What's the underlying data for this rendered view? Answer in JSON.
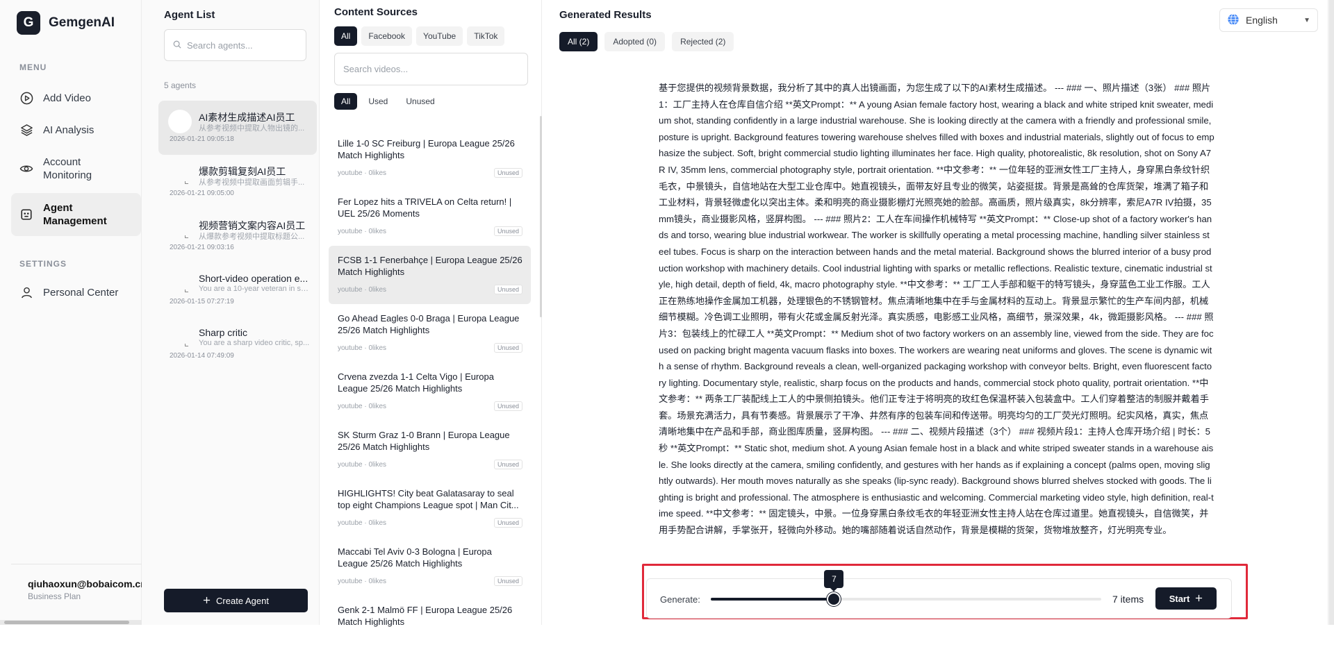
{
  "brand": {
    "logo_letter": "G",
    "name": "GemgenAI"
  },
  "menu": {
    "section_label": "MENU",
    "items": [
      {
        "label": "Add Video",
        "icon": "play-circle-icon"
      },
      {
        "label": "AI Analysis",
        "icon": "layers-icon"
      },
      {
        "label": "Account Monitoring",
        "icon": "eye-icon"
      },
      {
        "label": "Agent Management",
        "icon": "agent-icon",
        "active": true
      }
    ]
  },
  "settings": {
    "section_label": "SETTINGS",
    "items": [
      {
        "label": "Personal Center",
        "icon": "user-icon"
      }
    ]
  },
  "user": {
    "email": "qiuhaoxun@bobaicom.cn",
    "plan": "Business Plan"
  },
  "agent_panel": {
    "title": "Agent List",
    "search_placeholder": "Search agents...",
    "count": "5 agents",
    "agents": [
      {
        "name": "AI素材生成描述AI员工",
        "desc": "从参考视频中提取人物出镜的...",
        "date": "2026-01-21 09:05:18",
        "active": true
      },
      {
        "name": "爆款剪辑复刻AI员工",
        "desc": "从参考视频中提取画面剪辑手...",
        "date": "2026-01-21 09:05:00"
      },
      {
        "name": "视频营销文案内容AI员工",
        "desc": "从爆款参考视频中提取标题公...",
        "date": "2026-01-21 09:03:16"
      },
      {
        "name": "Short-video operation e...",
        "desc": "You are a 10-year veteran in sh...",
        "date": "2026-01-15 07:27:19"
      },
      {
        "name": "Sharp critic",
        "desc": "You are a sharp video critic, sp...",
        "date": "2026-01-14 07:49:09"
      }
    ],
    "create_label": "Create Agent"
  },
  "sources_panel": {
    "title": "Content Sources",
    "platform_tabs": [
      "All",
      "Facebook",
      "YouTube",
      "TikTok"
    ],
    "search_placeholder": "Search videos...",
    "usage_tabs": [
      "All",
      "Used",
      "Unused"
    ],
    "videos": [
      {
        "title": "Lille 1-0 SC Freiburg | Europa League 25/26 Match Highlights",
        "meta": "youtube · 0likes",
        "badge": "Unused"
      },
      {
        "title": "Fer Lopez hits a TRIVELA on Celta return! | UEL 25/26 Moments",
        "meta": "youtube · 0likes",
        "badge": "Unused"
      },
      {
        "title": "FCSB 1-1 Fenerbahçe | Europa League 25/26 Match Highlights",
        "meta": "youtube · 0likes",
        "badge": "Unused",
        "active": true
      },
      {
        "title": "Go Ahead Eagles 0-0 Braga | Europa League 25/26 Match Highlights",
        "meta": "youtube · 0likes",
        "badge": "Unused"
      },
      {
        "title": "Crvena zvezda 1-1 Celta Vigo | Europa League 25/26 Match Highlights",
        "meta": "youtube · 0likes",
        "badge": "Unused"
      },
      {
        "title": "SK Sturm Graz 1-0 Brann | Europa League 25/26 Match Highlights",
        "meta": "youtube · 0likes",
        "badge": "Unused"
      },
      {
        "title": "HIGHLIGHTS! City beat Galatasaray to seal top eight Champions League spot | Man Cit...",
        "meta": "youtube · 0likes",
        "badge": "Unused"
      },
      {
        "title": "Maccabi Tel Aviv 0-3 Bologna | Europa League 25/26 Match Highlights",
        "meta": "youtube · 0likes",
        "badge": "Unused"
      },
      {
        "title": "Genk 2-1 Malmö FF | Europa League 25/26 Match Highlights",
        "meta": "",
        "badge": ""
      }
    ]
  },
  "results_panel": {
    "title": "Generated Results",
    "tabs": [
      "All (2)",
      "Adopted (0)",
      "Rejected (2)"
    ],
    "text": "基于您提供的视频背景数据，我分析了其中的真人出镜画面，为您生成了以下的AI素材生成描述。 --- ### 一、照片描述（3张） ### 照片1：工厂主持人在仓库自信介绍 **英文Prompt：** A young Asian female factory host, wearing a black and white striped knit sweater, medium shot, standing confidently in a large industrial warehouse. She is looking directly at the camera with a friendly and professional smile, posture is upright. Background features towering warehouse shelves filled with boxes and industrial materials, slightly out of focus to emphasize the subject. Soft, bright commercial studio lighting illuminates her face. High quality, photorealistic, 8k resolution, shot on Sony A7R IV, 35mm lens, commercial photography style, portrait orientation. **中文参考：** 一位年轻的亚洲女性工厂主持人，身穿黑白条纹针织毛衣，中景镜头，自信地站在大型工业仓库中。她直视镜头，面带友好且专业的微笑，站姿挺拔。背景是高耸的仓库货架，堆满了箱子和工业材料，背景轻微虚化以突出主体。柔和明亮的商业摄影棚灯光照亮她的脸部。高画质，照片级真实，8k分辨率，索尼A7R IV拍摄，35mm镜头，商业摄影风格，竖屏构图。 --- ### 照片2：工人在车间操作机械特写 **英文Prompt：** Close-up shot of a factory worker's hands and torso, wearing blue industrial workwear. The worker is skillfully operating a metal processing machine, handling silver stainless steel tubes. Focus is sharp on the interaction between hands and the metal material. Background shows the blurred interior of a busy production workshop with machinery details. Cool industrial lighting with sparks or metallic reflections. Realistic texture, cinematic industrial style, high detail, depth of field, 4k, macro photography style. **中文参考：** 工厂工人手部和躯干的特写镜头，身穿蓝色工业工作服。工人正在熟练地操作金属加工机器，处理银色的不锈钢管材。焦点清晰地集中在手与金属材料的互动上。背景显示繁忙的生产车间内部，机械细节模糊。冷色调工业照明，带有火花或金属反射光泽。真实质感，电影感工业风格，高细节，景深效果，4k，微距摄影风格。 --- ### 照片3：包装线上的忙碌工人 **英文Prompt：** Medium shot of two factory workers on an assembly line, viewed from the side. They are focused on packing bright magenta vacuum flasks into boxes. The workers are wearing neat uniforms and gloves. The scene is dynamic with a sense of rhythm. Background reveals a clean, well-organized packaging workshop with conveyor belts. Bright, even fluorescent factory lighting. Documentary style, realistic, sharp focus on the products and hands, commercial stock photo quality, portrait orientation. **中文参考：** 两条工厂装配线上工人的中景侧拍镜头。他们正专注于将明亮的玫红色保温杯装入包装盒中。工人们穿着整洁的制服并戴着手套。场景充满活力，具有节奏感。背景展示了干净、井然有序的包装车间和传送带。明亮均匀的工厂荧光灯照明。纪实风格，真实，焦点清晰地集中在产品和手部，商业图库质量，竖屏构图。 --- ### 二、视频片段描述（3个） ### 视频片段1：主持人仓库开场介绍 | 时长：5秒 **英文Prompt：** Static shot, medium shot. A young Asian female host in a black and white striped sweater stands in a warehouse aisle. She looks directly at the camera, smiling confidently, and gestures with her hands as if explaining a concept (palms open, moving slightly outwards). Her mouth moves naturally as she speaks (lip-sync ready). Background shows blurred shelves stocked with goods. The lighting is bright and professional. The atmosphere is enthusiastic and welcoming. Commercial marketing video style, high definition, real-time speed. **中文参考：** 固定镜头，中景。一位身穿黑白条纹毛衣的年轻亚洲女性主持人站在仓库过道里。她直视镜头，自信微笑，并用手势配合讲解，手掌张开，轻微向外移动。她的嘴部随着说话自然动作，背景是模糊的货架，货物堆放整齐，灯光明亮专业。",
    "generate_label": "Generate:",
    "generate_value": 7,
    "generate_min": 1,
    "generate_max": 20,
    "generate_count": "7 items",
    "start_label": "Start"
  },
  "language": {
    "label": "English",
    "icon": "globe-icon"
  },
  "colors": {
    "primary": "#151b29",
    "highlight": "#e0293a",
    "sidebar_bg": "#fafafa"
  }
}
